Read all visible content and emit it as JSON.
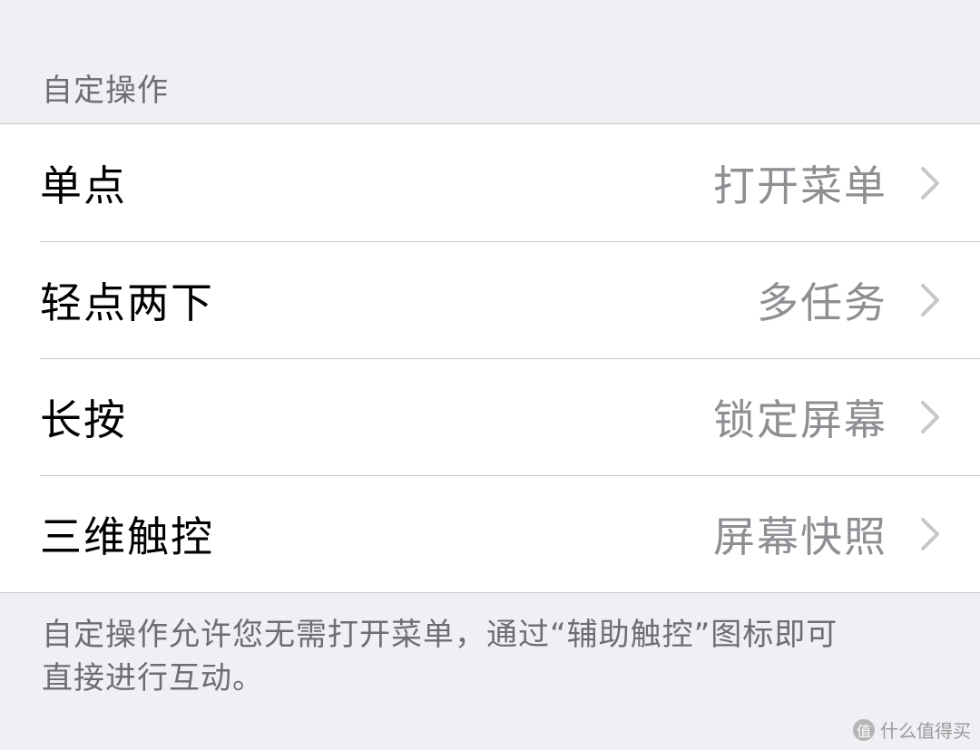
{
  "section": {
    "header": "自定操作"
  },
  "actions": [
    {
      "label": "单点",
      "value": "打开菜单"
    },
    {
      "label": "轻点两下",
      "value": "多任务"
    },
    {
      "label": "长按",
      "value": "锁定屏幕"
    },
    {
      "label": "三维触控",
      "value": "屏幕快照"
    }
  ],
  "footer": {
    "line1": "自定操作允许您无需打开菜单，通过“辅助触控”图标即可",
    "line2": "直接进行互动。"
  },
  "watermark": {
    "logo_glyph": "值",
    "text": "什么值得买"
  },
  "colors": {
    "background": "#efeff4",
    "cell": "#ffffff",
    "separator": "#c8c7cc",
    "secondary_text": "#8e8e93",
    "header_text": "#6d6d72"
  },
  "icons": {
    "row_accessory": "chevron-right-icon"
  }
}
